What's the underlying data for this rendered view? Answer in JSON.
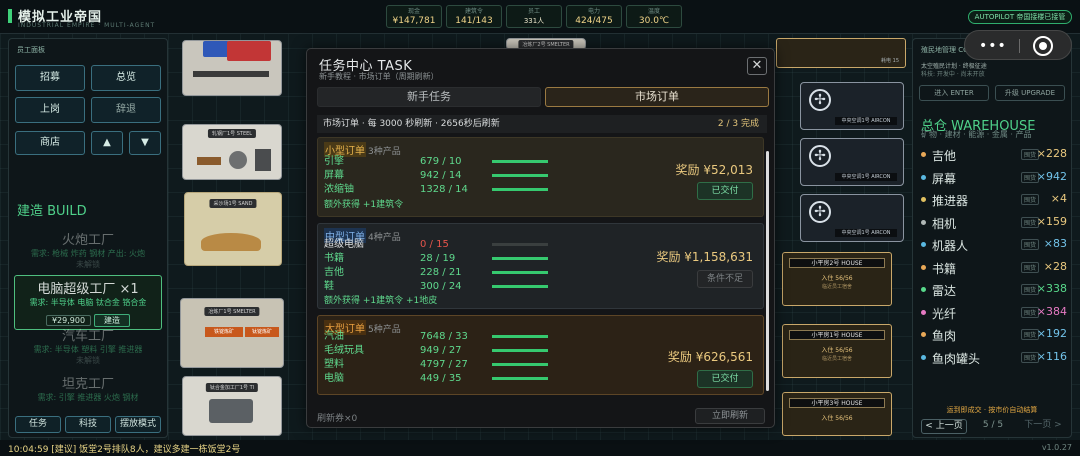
{
  "app": {
    "title": "模拟工业帝国",
    "subtitle": "INDUSTRIAL EMPIRE · MULTI-AGENT"
  },
  "stats": [
    {
      "label": "现金",
      "value": "¥147,781"
    },
    {
      "label": "建筑令",
      "value": "141/143"
    },
    {
      "label": "员工",
      "value": "331人"
    },
    {
      "label": "电力",
      "value": "424/475"
    },
    {
      "label": "温度",
      "value": "30.0℃"
    }
  ],
  "autopilot": "AUTOPILOT 帝国接楼已接管",
  "left_panel": {
    "header": "员工面板",
    "buttons": {
      "recruit": "招募",
      "overview": "总览",
      "onduty": "上岗",
      "resign": "辞退",
      "shop": "商店"
    },
    "build_header": "建造 BUILD",
    "items": [
      {
        "name": "火炮工厂",
        "req": "需求: 枪械 炸药 钢材  产出: 火炮",
        "status": "未解锁"
      },
      {
        "name": "电脑超级工厂 ×1",
        "req": "需求: 半导体 电脑 钛合金 铬合金",
        "price": "¥29,900",
        "build": "建造"
      },
      {
        "name": "汽车工厂",
        "req": "需求: 半导体 塑料 引擎 推进器",
        "status": "未解锁"
      },
      {
        "name": "坦克工厂",
        "req": "需求: 引擎 推进器 火炮 钢材",
        "status": "未解锁"
      }
    ],
    "bottom_buttons": {
      "task": "任务",
      "tech": "科技",
      "placemode": "摆放模式"
    }
  },
  "map": {
    "steel_plate": "轧钢厂1号 STEEL",
    "sand_plate": "采沙场1号 SAND",
    "smelter_plate": "冶炼厂1号 SMELTER",
    "smelter2_plate": "冶炼厂2号 SMELTER",
    "ti_plate": "钛合金加工厂1号 TI",
    "aircon_plate": "中央空调1号 AIRCON",
    "house_plates": [
      "小平房2号 HOUSE",
      "小平房1号 HOUSE",
      "小平房3号 HOUSE"
    ],
    "house_in": "入住 56/56",
    "house_note": "临近员工宿舍",
    "smelter_labels": [
      "铁锭炼矿",
      "钛锭炼矿"
    ],
    "power_tag": "耗电 15"
  },
  "right_panel": {
    "colony_header": "殖民地管理 COLONY",
    "colony_line1": "太空殖民计划 · 终极征途",
    "colony_line2": "科技: 开发中 · 尚未开放",
    "enter_btn": "进入 ENTER",
    "upgrade_btn": "升级 UPGRADE",
    "warehouse_header": "总仓 WAREHOUSE",
    "warehouse_sub": "矿物 · 建材 · 能源 · 金属 · 产品",
    "items": [
      {
        "name": "吉他",
        "qty": "×228",
        "dot": "#e8a857",
        "tone": "gold"
      },
      {
        "name": "屏幕",
        "qty": "×942",
        "dot": "#5ab8e0",
        "tone": "blue"
      },
      {
        "name": "推进器",
        "qty": "×4",
        "dot": "#e0c060",
        "tone": "gold"
      },
      {
        "name": "相机",
        "qty": "×159",
        "dot": "#b0b8b6",
        "tone": "gold"
      },
      {
        "name": "机器人",
        "qty": "×83",
        "dot": "#5ab8e0",
        "tone": "blue"
      },
      {
        "name": "书籍",
        "qty": "×28",
        "dot": "#e8a857",
        "tone": "gold"
      },
      {
        "name": "雷达",
        "qty": "×338",
        "dot": "#58d98b",
        "tone": "green"
      },
      {
        "name": "光纤",
        "qty": "×384",
        "dot": "#e67ac3",
        "tone": "pink"
      },
      {
        "name": "鱼肉",
        "qty": "×192",
        "dot": "#e8a857",
        "tone": "blue"
      },
      {
        "name": "鱼肉罐头",
        "qty": "×116",
        "dot": "#5ab8e0",
        "tone": "blue"
      }
    ],
    "item_tag": "囤货",
    "note": "运到即成交 · 按市价自动结算",
    "prev": "< 上一页",
    "page": "5 / 5",
    "next": "下一页 >"
  },
  "bottom": {
    "log": "10:04:59  [建议] 饭堂2号排队8人，建议多建一栋饭堂2号",
    "version": "v1.0.27"
  },
  "modal": {
    "title": "任务中心  TASK",
    "subtitle": "新手教程 · 市场订单（周期刷新）",
    "close": "✕",
    "tab_newbie": "新手任务",
    "tab_market": "市场订单",
    "info": "市场订单 · 每 3000 秒刷新 · 2656秒后刷新",
    "completed": "2 / 3 完成",
    "orders": [
      {
        "type": "小型订单",
        "count": "3种产品",
        "rows": [
          {
            "name": "引擎",
            "qty": "679 / 10",
            "fill": 1.0
          },
          {
            "name": "屏幕",
            "qty": "942 / 14",
            "fill": 1.0
          },
          {
            "name": "浓缩铀",
            "qty": "1328 / 14",
            "fill": 1.0
          }
        ],
        "extra": "额外获得 +1建筑令",
        "reward": "奖励 ¥52,013",
        "status": "已交付"
      },
      {
        "type": "中型订单",
        "count": "4种产品",
        "rows": [
          {
            "name": "超级电脑",
            "qty": "0 / 15",
            "fill": 0.0,
            "lack": true
          },
          {
            "name": "书籍",
            "qty": "28 / 19",
            "fill": 1.0
          },
          {
            "name": "吉他",
            "qty": "228 / 21",
            "fill": 1.0
          },
          {
            "name": "鞋",
            "qty": "300 / 24",
            "fill": 1.0
          }
        ],
        "extra": "额外获得 +1建筑令 +1地皮",
        "reward": "奖励 ¥1,158,631",
        "status": "条件不足"
      },
      {
        "type": "大型订单",
        "count": "5种产品",
        "rows": [
          {
            "name": "汽油",
            "qty": "7648 / 33",
            "fill": 1.0
          },
          {
            "name": "毛绒玩具",
            "qty": "949 / 27",
            "fill": 1.0
          },
          {
            "name": "塑料",
            "qty": "4797 / 27",
            "fill": 1.0
          },
          {
            "name": "电脑",
            "qty": "449 / 35",
            "fill": 1.0
          }
        ],
        "extra": "",
        "reward": "奖励 ¥626,561",
        "status": "已交付"
      }
    ],
    "footer": "刷新券×0",
    "refresh": "立即刷新"
  },
  "wechat": {
    "more": "•••"
  }
}
